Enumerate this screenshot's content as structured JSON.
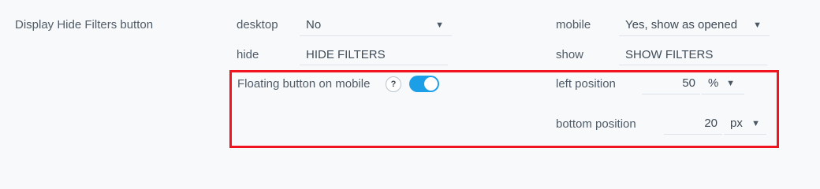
{
  "section": {
    "title": "Display Hide Filters button"
  },
  "desktop": {
    "label": "desktop",
    "value": "No"
  },
  "mobile": {
    "label": "mobile",
    "value": "Yes, show as opened"
  },
  "hide": {
    "label": "hide",
    "value": "HIDE FILTERS"
  },
  "show": {
    "label": "show",
    "value": "SHOW FILTERS"
  },
  "floating": {
    "label": "Floating button on mobile",
    "help_glyph": "?",
    "enabled": true
  },
  "left_position": {
    "label": "left position",
    "value": "50",
    "unit": "%"
  },
  "bottom_position": {
    "label": "bottom position",
    "value": "20",
    "unit": "px"
  },
  "icons": {
    "caret": "▼"
  },
  "colors": {
    "toggle_on": "#1c9fe6",
    "highlight": "#f0141e"
  }
}
